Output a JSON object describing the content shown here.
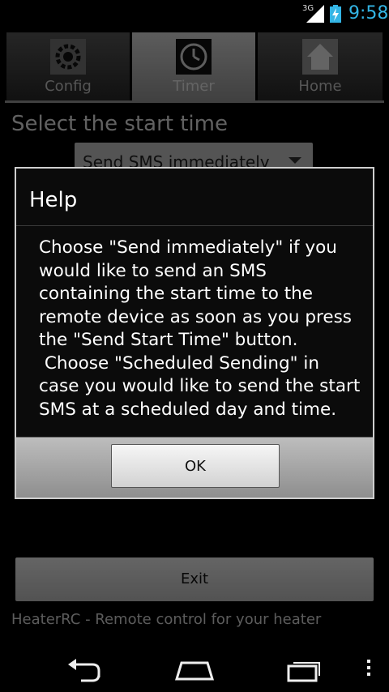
{
  "status_bar": {
    "network": "3G",
    "time": "9:58"
  },
  "app": {
    "tabs": [
      {
        "label": "Config",
        "icon": "gear-icon"
      },
      {
        "label": "Timer",
        "icon": "clock-icon"
      },
      {
        "label": "Home",
        "icon": "house-icon"
      }
    ],
    "section_title": "Select the start time",
    "spinner_value": "Send SMS immediately",
    "help_glyph": "?",
    "exit_label": "Exit",
    "footer": "HeaterRC - Remote control for your heater"
  },
  "dialog": {
    "title": "Help",
    "message": "Choose \"Send immediately\" if you would like to send an SMS containing the start time to the remote device as soon as you press the \"Send Start Time\" button.\n Choose \"Scheduled Sending\" in case you would like to send the start SMS at a scheduled day and time.",
    "ok_label": "OK"
  },
  "nav_bar": {
    "icons": [
      "back-icon",
      "home-icon",
      "recent-apps-icon",
      "menu-icon"
    ]
  }
}
